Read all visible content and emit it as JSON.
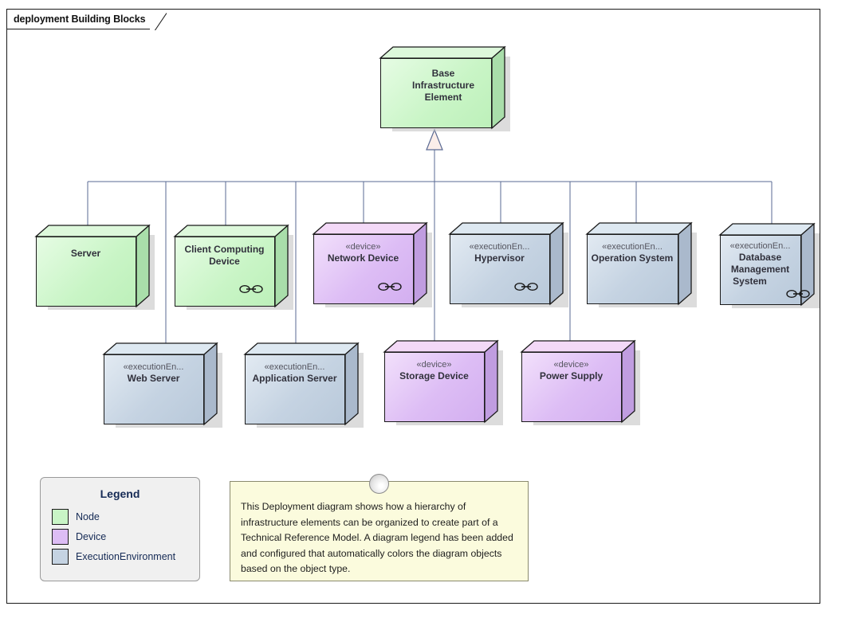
{
  "window": {
    "tab_label": "deployment Building Blocks"
  },
  "colors": {
    "node_fill": "#c9f5c6",
    "node_fill_light": "#e6fce4",
    "node_side": "#a9deaa",
    "node_top": "#ddf8db",
    "device_fill": "#ddbdf5",
    "device_fill_light": "#f2e0fb",
    "device_side": "#c09de0",
    "device_top": "#f3d9f7",
    "execenv_fill": "#c5d3e2",
    "execenv_fill_light": "#e2eaf2",
    "execenv_side": "#aab9cc",
    "execenv_top": "#dde8f1",
    "connector": "#5a6a93",
    "outline": "#1a1a1a",
    "note_fill": "#fbfbdd",
    "note_border": "#8a8a6e",
    "legend_fill": "#f0f0f0",
    "legend_text": "#152a55"
  },
  "diagram": {
    "root": {
      "name": "Base\nInfrastructure\nElement",
      "name_lines": [
        "Base",
        "Infrastructure",
        "Element"
      ],
      "stereotype": "",
      "type": "Node",
      "composite": false
    },
    "row2": [
      {
        "name_lines": [
          "Server"
        ],
        "stereotype": "",
        "type": "Node",
        "composite": false
      },
      {
        "name_lines": [
          "Client Computing",
          "Device"
        ],
        "stereotype": "",
        "type": "Node",
        "composite": true
      },
      {
        "name_lines": [
          "Network Device"
        ],
        "stereotype": "«device»",
        "type": "Device",
        "composite": true
      },
      {
        "name_lines": [
          "Hypervisor"
        ],
        "stereotype": "«executionEn...",
        "type": "ExecutionEnvironment",
        "composite": true
      },
      {
        "name_lines": [
          "Operation System"
        ],
        "stereotype": "«executionEn...",
        "type": "ExecutionEnvironment",
        "composite": false
      },
      {
        "name_lines": [
          "Database",
          "Management",
          "System"
        ],
        "stereotype": "«executionEn...",
        "type": "ExecutionEnvironment",
        "composite": true
      }
    ],
    "row3": [
      {
        "name_lines": [
          "Web Server"
        ],
        "stereotype": "«executionEn...",
        "type": "ExecutionEnvironment",
        "composite": false
      },
      {
        "name_lines": [
          "Application Server"
        ],
        "stereotype": "«executionEn...",
        "type": "ExecutionEnvironment",
        "composite": false
      },
      {
        "name_lines": [
          "Storage Device"
        ],
        "stereotype": "«device»",
        "type": "Device",
        "composite": false
      },
      {
        "name_lines": [
          "Power Supply"
        ],
        "stereotype": "«device»",
        "type": "Device",
        "composite": false
      }
    ]
  },
  "legend": {
    "title": "Legend",
    "items": [
      {
        "label": "Node",
        "color": "#c9f5c6"
      },
      {
        "label": "Device",
        "color": "#ddbdf5"
      },
      {
        "label": "ExecutionEnvironment",
        "color": "#c5d3e2"
      }
    ]
  },
  "note": {
    "text": "This Deployment diagram shows how a hierarchy of infrastructure elements can be organized to create part of a Technical Reference Model. A diagram legend has been added and configured that automatically colors the diagram objects based on the object type."
  }
}
